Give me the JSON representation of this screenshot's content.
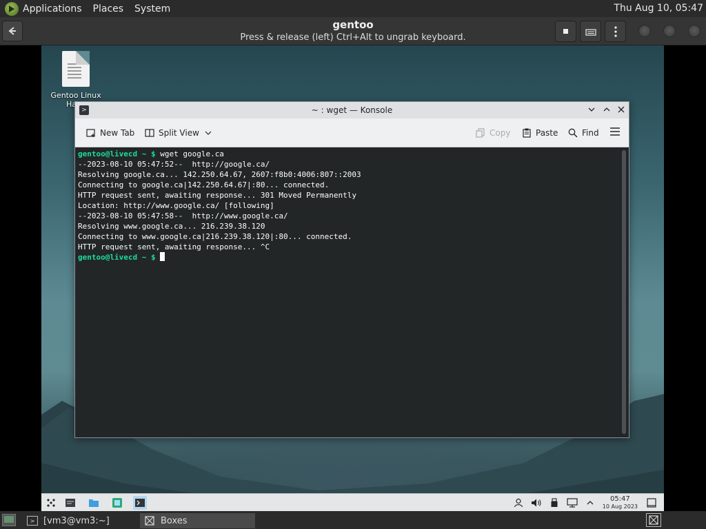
{
  "host_top_panel": {
    "menus": [
      "Applications",
      "Places",
      "System"
    ],
    "clock": "Thu Aug 10, 05:47"
  },
  "boxes_header": {
    "title": "gentoo",
    "subtitle": "Press & release (left) Ctrl+Alt to ungrab keyboard."
  },
  "desktop": {
    "icon_label_line1": "Gentoo Linux",
    "icon_label_line2": "Hanc"
  },
  "konsole": {
    "window_title": "~ : wget — Konsole",
    "toolbar": {
      "new_tab": "New Tab",
      "split_view": "Split View",
      "copy": "Copy",
      "paste": "Paste",
      "find": "Find"
    },
    "prompt": "gentoo@livecd ~ $",
    "command": "wget google.ca",
    "output": [
      "--2023-08-10 05:47:52--  http://google.ca/",
      "Resolving google.ca... 142.250.64.67, 2607:f8b0:4006:807::2003",
      "Connecting to google.ca|142.250.64.67|:80... connected.",
      "HTTP request sent, awaiting response... 301 Moved Permanently",
      "Location: http://www.google.ca/ [following]",
      "--2023-08-10 05:47:58--  http://www.google.ca/",
      "Resolving www.google.ca... 216.239.38.120",
      "Connecting to www.google.ca|216.239.38.120|:80... connected.",
      "HTTP request sent, awaiting response... ^C"
    ]
  },
  "guest_panel": {
    "time": "05:47",
    "date": "10 Aug 2023"
  },
  "host_bottom_panel": {
    "tasks": [
      "[vm3@vm3:~]",
      "Boxes"
    ]
  },
  "colors": {
    "prompt": "#1cdc9a",
    "terminal_bg": "#232627"
  }
}
